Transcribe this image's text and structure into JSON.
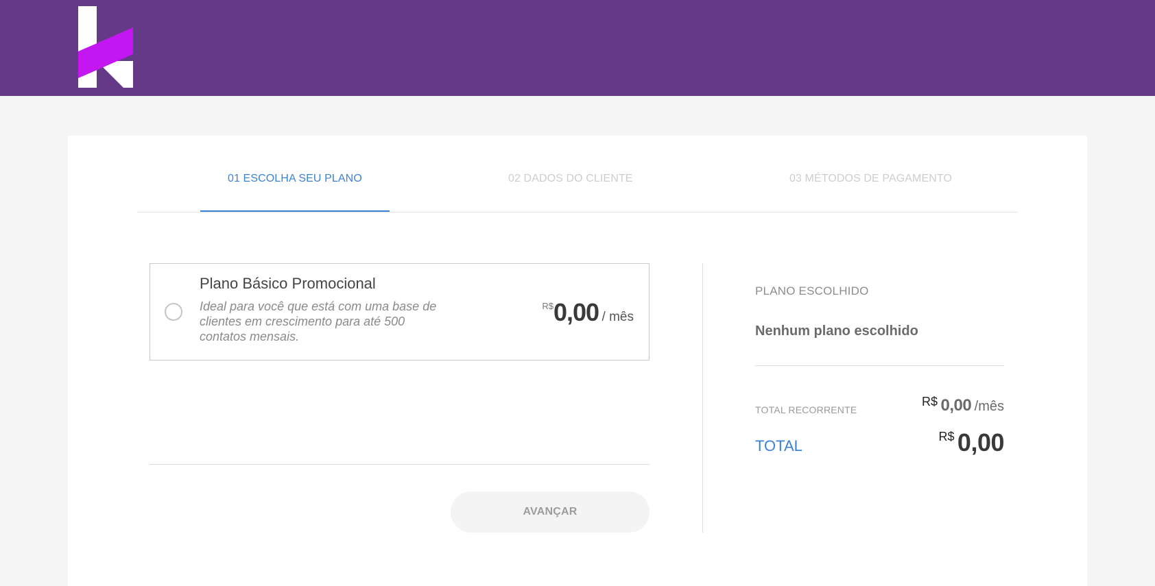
{
  "colors": {
    "brand_purple": "#643987",
    "logo_magenta": "#c316f0",
    "accent_blue": "#3b82d6"
  },
  "header": {
    "logo_icon": "k-brand-logo"
  },
  "steps": [
    {
      "label": "01 ESCOLHA SEU PLANO",
      "active": true
    },
    {
      "label": "02 DADOS DO CLIENTE",
      "active": false
    },
    {
      "label": "03 MÉTODOS DE PAGAMENTO",
      "active": false
    }
  ],
  "plan": {
    "name": "Plano Básico Promocional",
    "description": "Ideal para você que está com uma base de clientes em crescimento para até 500 contatos mensais.",
    "currency": "R$",
    "price": "0,00",
    "period": "/ mês",
    "selected": false
  },
  "actions": {
    "next_label": "AVANÇAR"
  },
  "summary": {
    "title": "PLANO ESCOLHIDO",
    "chosen_plan": "Nenhum plano escolhido",
    "recurring_label": "TOTAL RECORRENTE",
    "recurring_currency": "R$",
    "recurring_amount": "0,00",
    "recurring_period": "/mês",
    "total_label": "TOTAL",
    "total_currency": "R$",
    "total_amount": "0,00"
  }
}
